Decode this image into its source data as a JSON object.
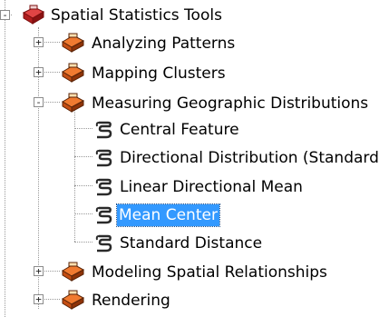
{
  "tree": {
    "root": {
      "label": "Spatial Statistics Tools",
      "expander": "-"
    },
    "toolsets": [
      {
        "label": "Analyzing Patterns",
        "expander": "+"
      },
      {
        "label": "Mapping Clusters",
        "expander": "+"
      },
      {
        "label": "Measuring Geographic Distributions",
        "expander": "-"
      },
      {
        "label": "Modeling Spatial Relationships",
        "expander": "+"
      },
      {
        "label": "Rendering",
        "expander": "+"
      }
    ],
    "tools": [
      {
        "label": "Central Feature"
      },
      {
        "label": "Directional Distribution (Standard"
      },
      {
        "label": "Linear Directional Mean"
      },
      {
        "label": "Mean Center"
      },
      {
        "label": "Standard Distance"
      }
    ],
    "selected": "Mean Center"
  },
  "colors": {
    "selection": "#3399ff",
    "toolbox_red": "#c0282a",
    "toolset_orange": "#d45a1b"
  }
}
